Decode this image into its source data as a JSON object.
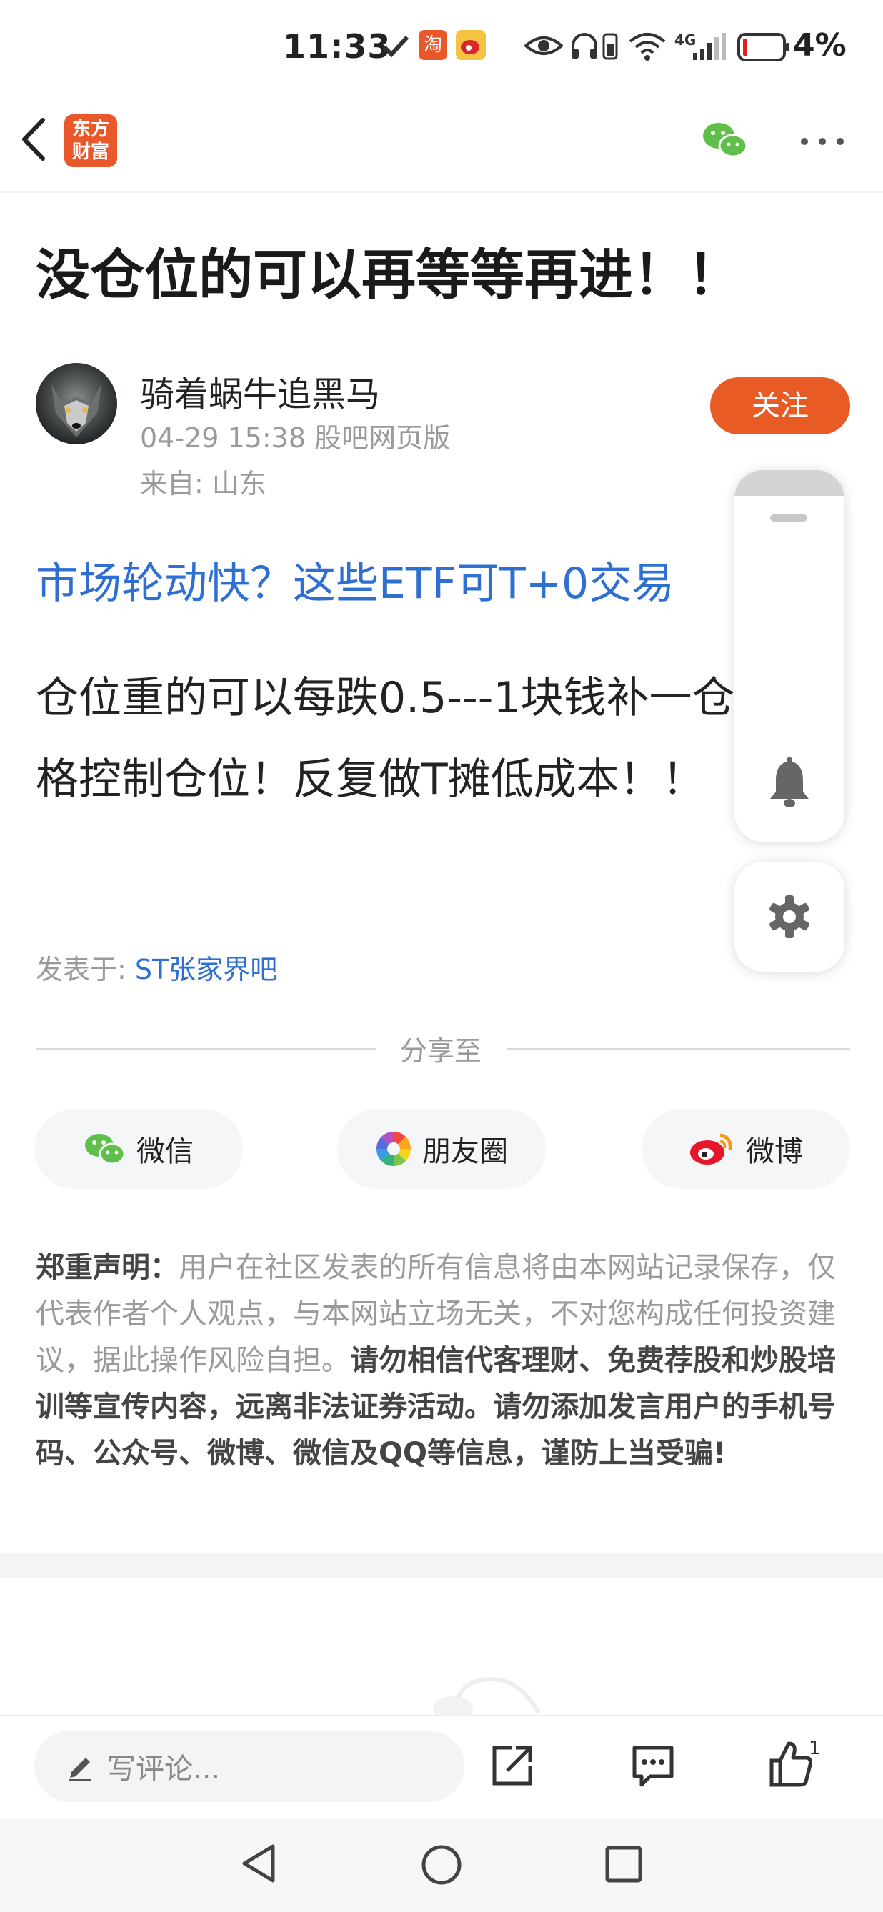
{
  "status_bar": {
    "time": "11:33",
    "network": "4G",
    "battery": "4%"
  },
  "nav": {
    "logo_line1": "东方",
    "logo_line2": "财富"
  },
  "post": {
    "title": "没仓位的可以再等等再进！！",
    "author": "骑着蜗牛追黑马",
    "meta": "04-29 15:38 股吧网页版",
    "from": "来自: 山东",
    "follow_label": "关注",
    "promo_link": "市场轮动快？这些ETF可T+0交易",
    "content": "仓位重的可以每跌0.5---1块钱补一仓，严格控制仓位！反复做T摊低成本！！",
    "posted_in_prefix": "发表于: ",
    "posted_in_link": "ST张家界吧"
  },
  "share": {
    "label": "分享至",
    "wechat": "微信",
    "moments": "朋友圈",
    "weibo": "微博"
  },
  "disclaimer": {
    "title": "郑重声明：",
    "normal": "用户在社区发表的所有信息将由本网站记录保存，仅代表作者个人观点，与本网站立场无关，不对您构成任何投资建议，据此操作风险自担。",
    "bold": "请勿相信代客理财、免费荐股和炒股培训等宣传内容，远离非法证券活动。请勿添加发言用户的手机号码、公众号、微博、微信及QQ等信息，谨防上当受骗!"
  },
  "bottom_bar": {
    "comment_placeholder": "写评论...",
    "like_count": "1"
  },
  "colors": {
    "brand_orange": "#e85b24",
    "link_blue": "#2e6fd1"
  }
}
